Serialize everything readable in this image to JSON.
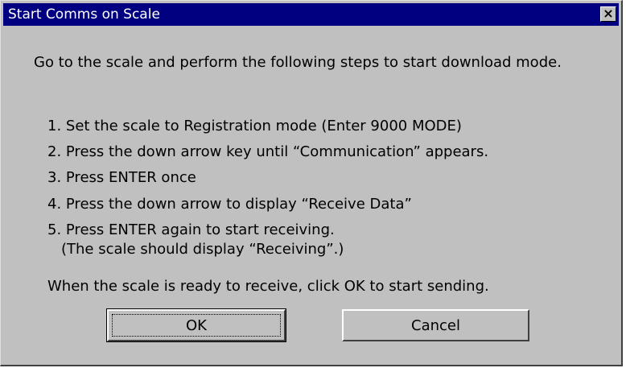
{
  "window": {
    "title": "Start Comms on Scale",
    "close_glyph": "×"
  },
  "intro": "Go to the scale and perform the following steps to start download mode.",
  "steps": [
    "1. Set the scale to Registration mode (Enter 9000 MODE)",
    "2. Press the down arrow key until “Communication” appears.",
    "3. Press ENTER once",
    "4. Press the down arrow to display “Receive Data”",
    "5. Press ENTER again to start receiving."
  ],
  "step5_note": "(The scale should display “Receiving”.)",
  "footer_message": "When the scale is ready to receive, click OK to start sending.",
  "buttons": {
    "ok": "OK",
    "cancel": "Cancel"
  },
  "colors": {
    "titlebar": "#000080",
    "dialog_face": "#c0c0c0"
  }
}
